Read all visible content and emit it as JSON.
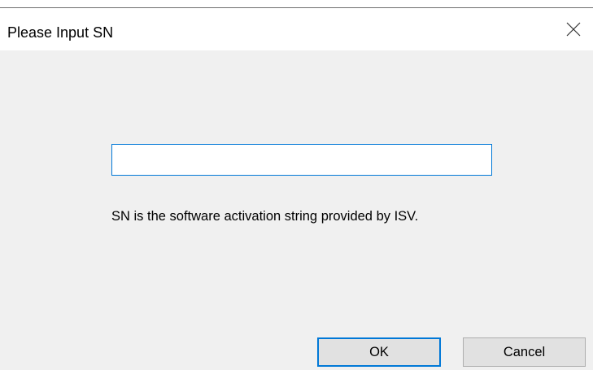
{
  "window": {
    "title": "Please Input SN",
    "close_icon": "close-icon"
  },
  "form": {
    "sn_value": "",
    "sn_placeholder": "",
    "hint_text": "SN is the software activation string provided by ISV."
  },
  "buttons": {
    "ok_label": "OK",
    "cancel_label": "Cancel"
  },
  "colors": {
    "accent": "#0078d7",
    "client_background": "#f0f0f0",
    "button_face": "#e1e1e1"
  }
}
